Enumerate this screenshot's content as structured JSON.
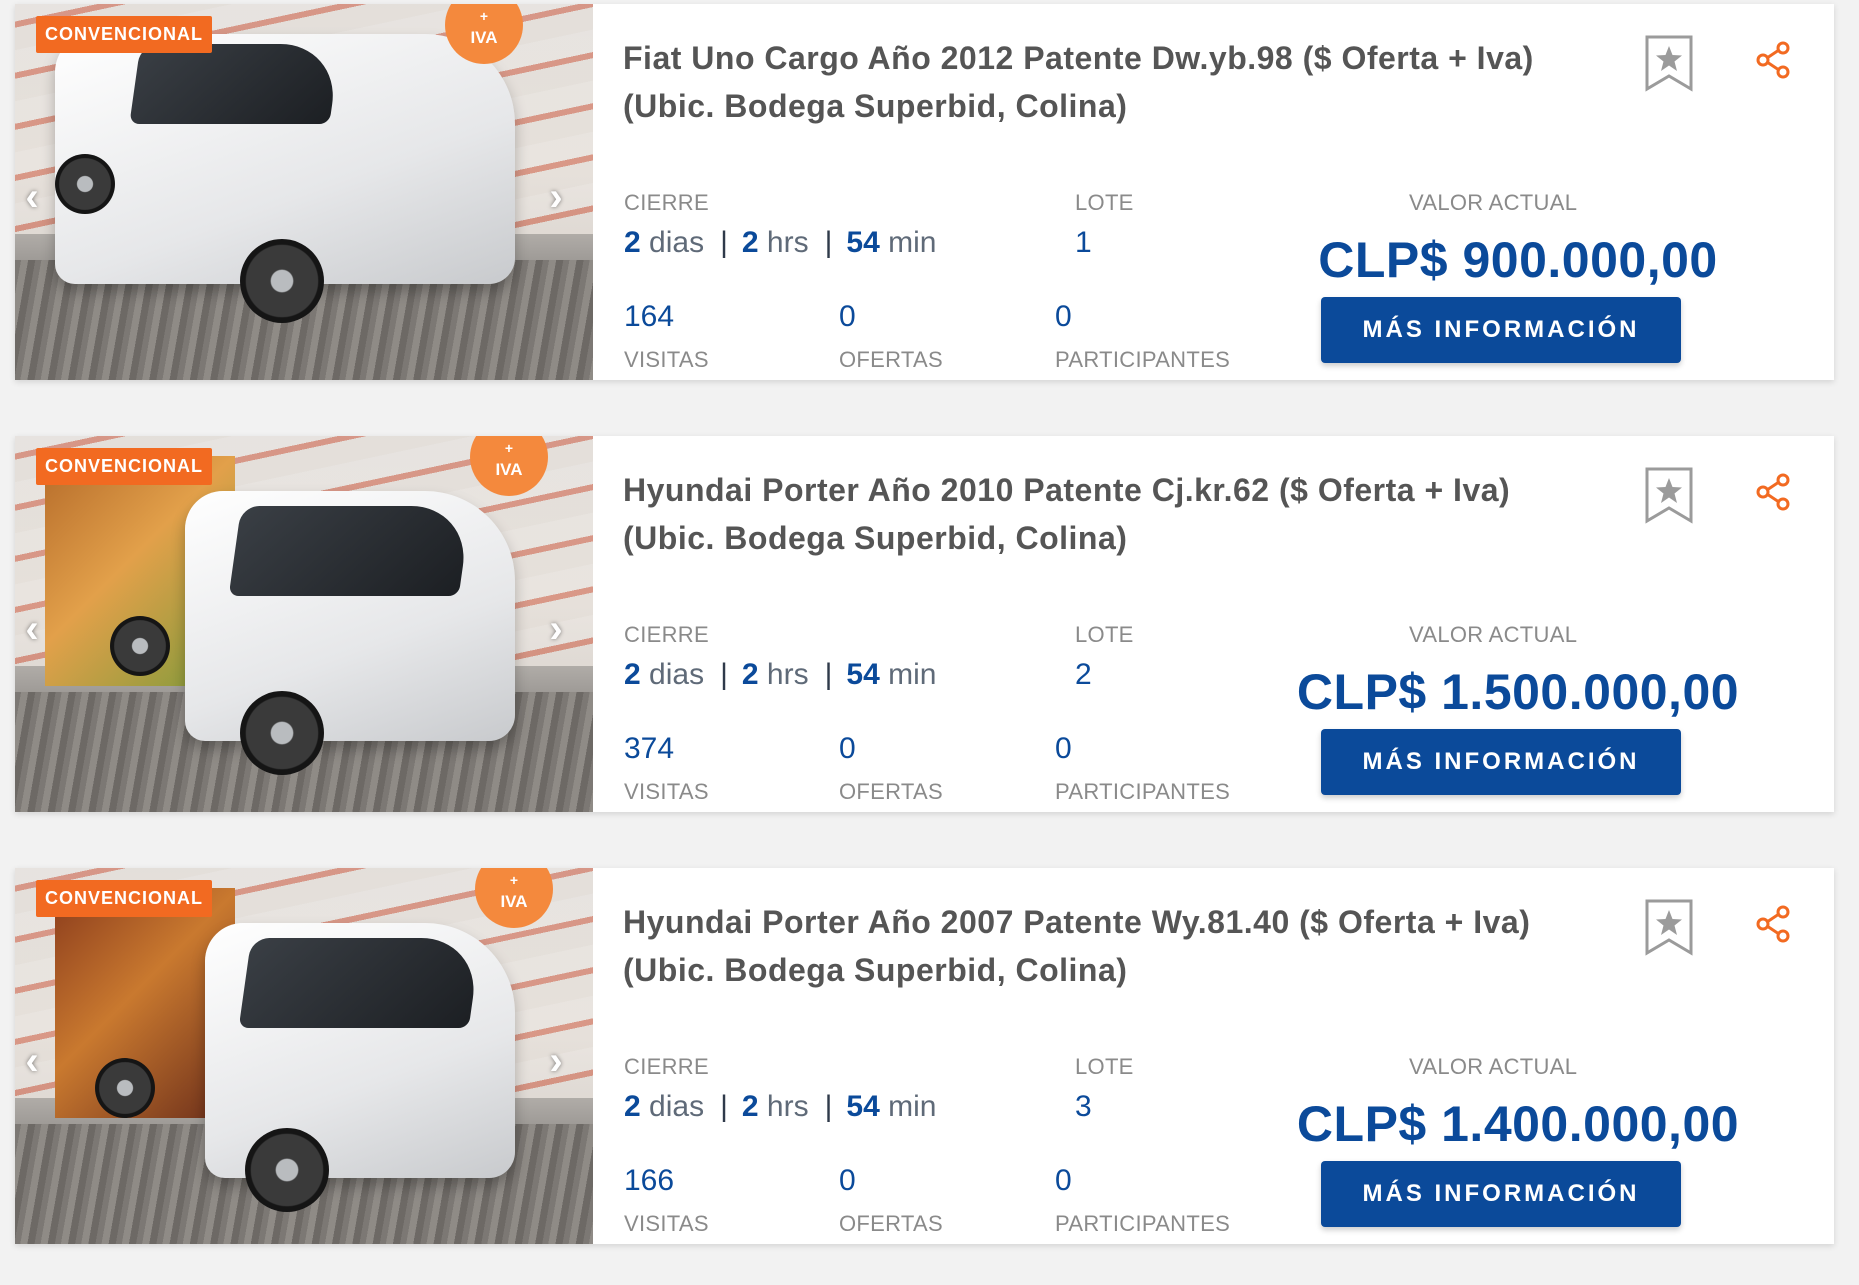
{
  "labels": {
    "badge": "CONVENCIONAL",
    "iva": "IVA",
    "iva_plus": "+",
    "cierre": "CIERRE",
    "lote": "LOTE",
    "valor_actual": "VALOR ACTUAL",
    "visitas": "VISITAS",
    "ofertas": "OFERTAS",
    "participantes": "PARTICIPANTES",
    "dias": "dias",
    "hrs": "hrs",
    "min": "min",
    "sep": "|",
    "button": "MÁS INFORMACIÓN"
  },
  "lots": [
    {
      "title": "Fiat Uno Cargo Año 2012 Patente Dw.yb.98 ($ Oferta + Iva) (Ubic. Bodega Superbid, Colina)",
      "days": "2",
      "hours": "2",
      "minutes": "54",
      "lote": "1",
      "price": "CLP$ 900.000,00",
      "visitas": "164",
      "ofertas": "0",
      "participantes": "0"
    },
    {
      "title": "Hyundai Porter Año 2010 Patente Cj.kr.62 ($ Oferta + Iva) (Ubic. Bodega Superbid, Colina)",
      "days": "2",
      "hours": "2",
      "minutes": "54",
      "lote": "2",
      "price": "CLP$ 1.500.000,00",
      "visitas": "374",
      "ofertas": "0",
      "participantes": "0"
    },
    {
      "title": "Hyundai Porter Año 2007 Patente Wy.81.40 ($ Oferta + Iva) (Ubic. Bodega Superbid, Colina)",
      "days": "2",
      "hours": "2",
      "minutes": "54",
      "lote": "3",
      "price": "CLP$ 1.400.000,00",
      "visitas": "166",
      "ofertas": "0",
      "participantes": "0"
    }
  ],
  "colors": {
    "accent_orange": "#f26a21",
    "primary_blue": "#0b4a9a"
  },
  "icons": {
    "bookmark": "bookmark-star-icon",
    "share": "share-icon",
    "prev": "chevron-left-icon",
    "next": "chevron-right-icon"
  }
}
